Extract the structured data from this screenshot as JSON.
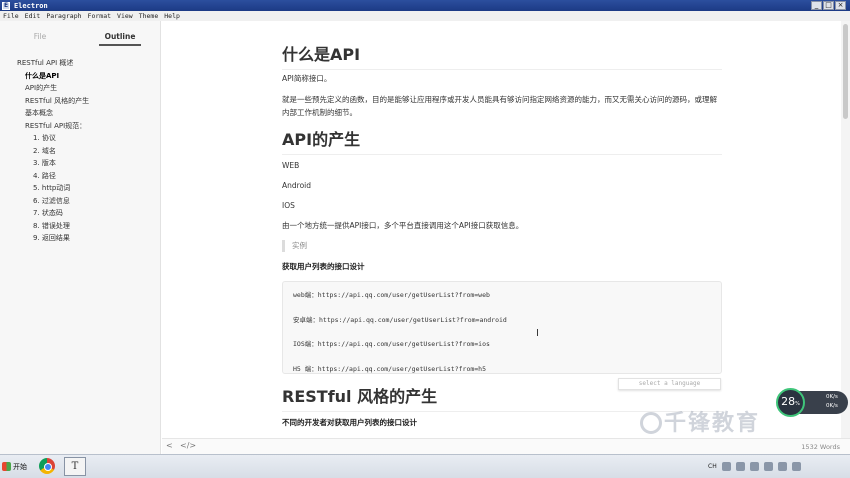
{
  "window": {
    "title": "Electron",
    "buttons": [
      "_",
      "□",
      "×"
    ]
  },
  "menu": [
    "File",
    "Edit",
    "Paragraph",
    "Format",
    "View",
    "Theme",
    "Help"
  ],
  "sidebar": {
    "tabs": [
      "File",
      "Outline"
    ],
    "outline": [
      {
        "label": "RESTful API 概述",
        "level": 1
      },
      {
        "label": "什么是API",
        "level": 2,
        "active": true
      },
      {
        "label": "API的产生",
        "level": 2
      },
      {
        "label": "RESTful 风格的产生",
        "level": 2
      },
      {
        "label": "基本概念",
        "level": 2
      },
      {
        "label": "RESTful API规范：",
        "level": 2
      },
      {
        "label": "1. 协议",
        "level": 3
      },
      {
        "label": "2. 域名",
        "level": 3
      },
      {
        "label": "3. 版本",
        "level": 3
      },
      {
        "label": "4. 路径",
        "level": 3
      },
      {
        "label": "5. http动词",
        "level": 3
      },
      {
        "label": "6. 过滤信息",
        "level": 3
      },
      {
        "label": "7. 状态码",
        "level": 3
      },
      {
        "label": "8. 错误处理",
        "level": 3
      },
      {
        "label": "9. 返回结果",
        "level": 3
      }
    ]
  },
  "doc": {
    "h1_what_is_api": "什么是API",
    "p_api_short": "API简称接口。",
    "p_api_desc": "就是一些预先定义的函数，目的是能够让应用程序或开发人员能具有够访问指定网络资源的能力，而又无需关心访问的源码，或理解内部工作机制的细节。",
    "h1_api_origin": "API的产生",
    "p_web": "WEB",
    "p_android": "Android",
    "p_ios": "IOS",
    "p_unified": "由一个地方统一提供API接口，多个平台直接调用这个API接口获取信息。",
    "quote_example": "实例",
    "h4_get_user_list": "获取用户列表的接口设计",
    "code_lines": [
      "web端：https://api.qq.com/user/getUserList?from=web",
      "安卓端：https://api.qq.com/user/getUserList?from=android",
      "IOS端：https://api.qq.com/user/getUserList?from=ios",
      "H5 端：https://api.qq.com/user/getUserList?from=h5"
    ],
    "lang_select_placeholder": "select a language",
    "h1_restful_origin": "RESTful 风格的产生",
    "h4_different_devs": "不同的开发者对获取用户列表的接口设计"
  },
  "footer": {
    "back_label": "<",
    "source_label": "</>",
    "word_count": "1532 Words"
  },
  "speed_widget": {
    "percent": "28",
    "percent_unit": "%",
    "up": "0K/s",
    "down": "0K/s"
  },
  "watermark": "千锋教育",
  "taskbar": {
    "start_label": "开始",
    "typora_glyph": "T",
    "tray": [
      "CH"
    ]
  }
}
